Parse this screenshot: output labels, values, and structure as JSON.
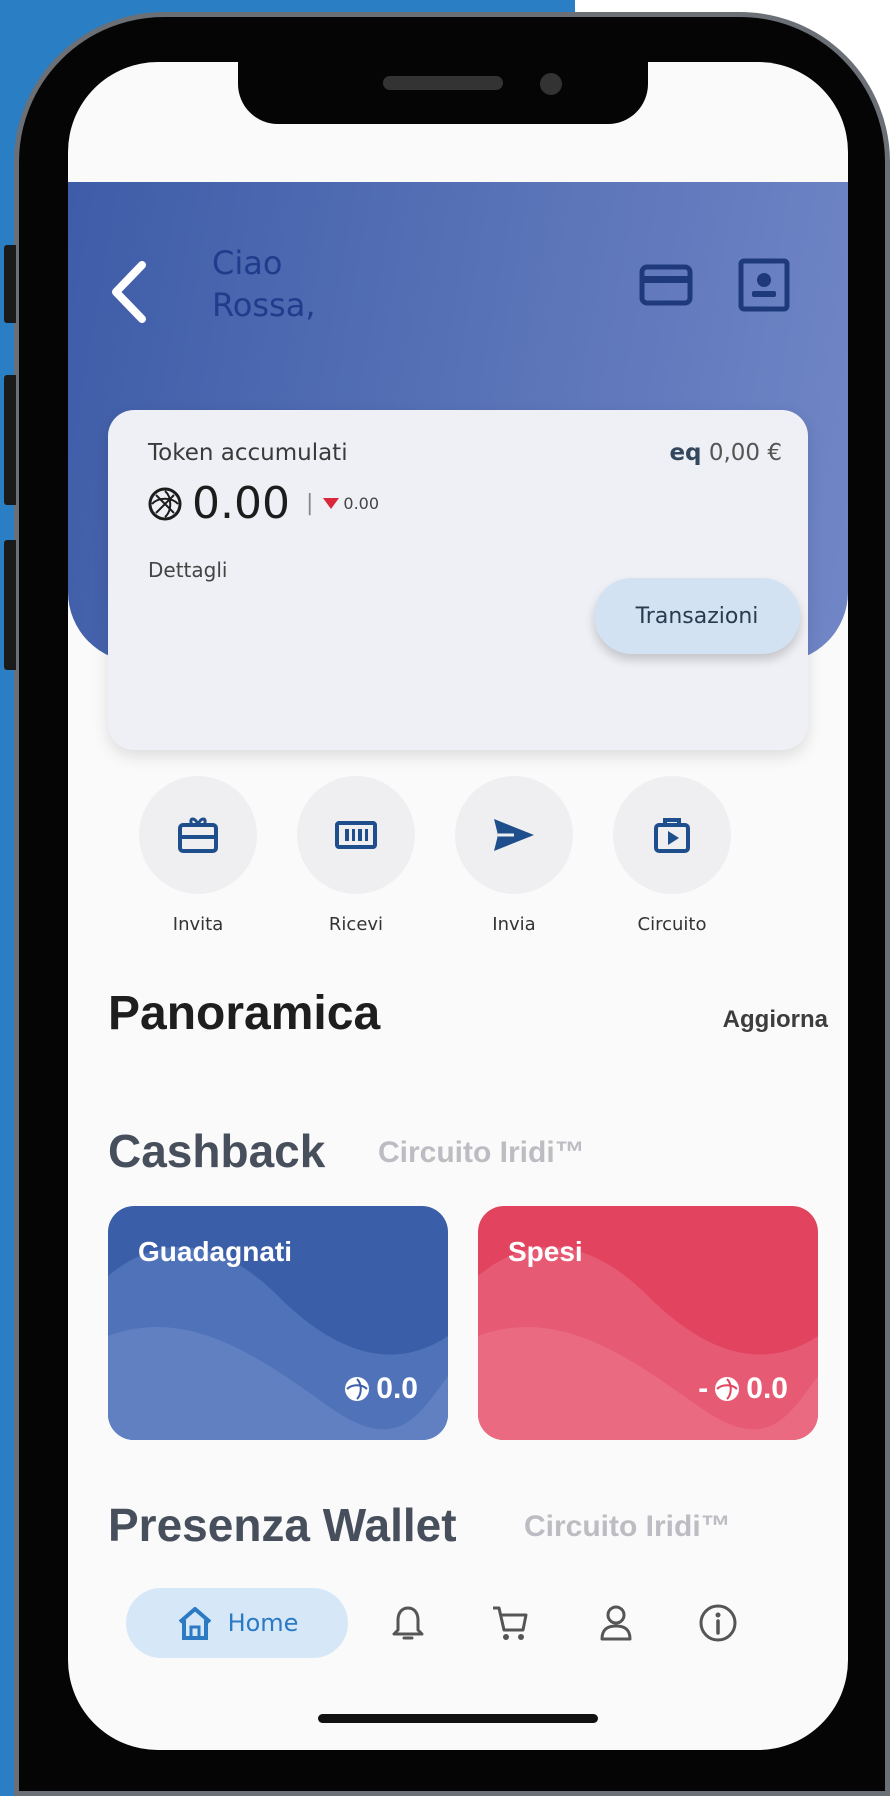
{
  "header": {
    "greeting_line1": "Ciao",
    "greeting_line2": "Rossa,"
  },
  "token_card": {
    "label": "Token accumulati",
    "eq_prefix": "eq",
    "eq_value": "0,00 €",
    "amount": "0.00",
    "change": "0.00",
    "details_label": "Dettagli",
    "transactions_button": "Transazioni"
  },
  "actions": [
    {
      "label": "Invita",
      "icon": "gift-card-icon"
    },
    {
      "label": "Ricevi",
      "icon": "barcode-icon"
    },
    {
      "label": "Invia",
      "icon": "send-icon"
    },
    {
      "label": "Circuito",
      "icon": "play-bag-icon"
    }
  ],
  "overview": {
    "title": "Panoramica",
    "refresh_label": "Aggiorna"
  },
  "cashback": {
    "title": "Cashback",
    "subtitle": "Circuito Iridi™",
    "earned": {
      "label": "Guadagnati",
      "value": "0.0"
    },
    "spent": {
      "label": "Spesi",
      "value": "0.0",
      "prefix": "-"
    }
  },
  "wallet": {
    "title": "Presenza Wallet",
    "subtitle": "Circuito Iridi™"
  },
  "nav": {
    "home_label": "Home",
    "items": [
      "home-icon",
      "bell-icon",
      "cart-icon",
      "user-icon",
      "info-icon"
    ]
  },
  "colors": {
    "header_blue": "#3e5ca8",
    "earned_blue": "#3a5ea8",
    "spent_red": "#e2445f",
    "accent_blue": "#2c79c4"
  }
}
